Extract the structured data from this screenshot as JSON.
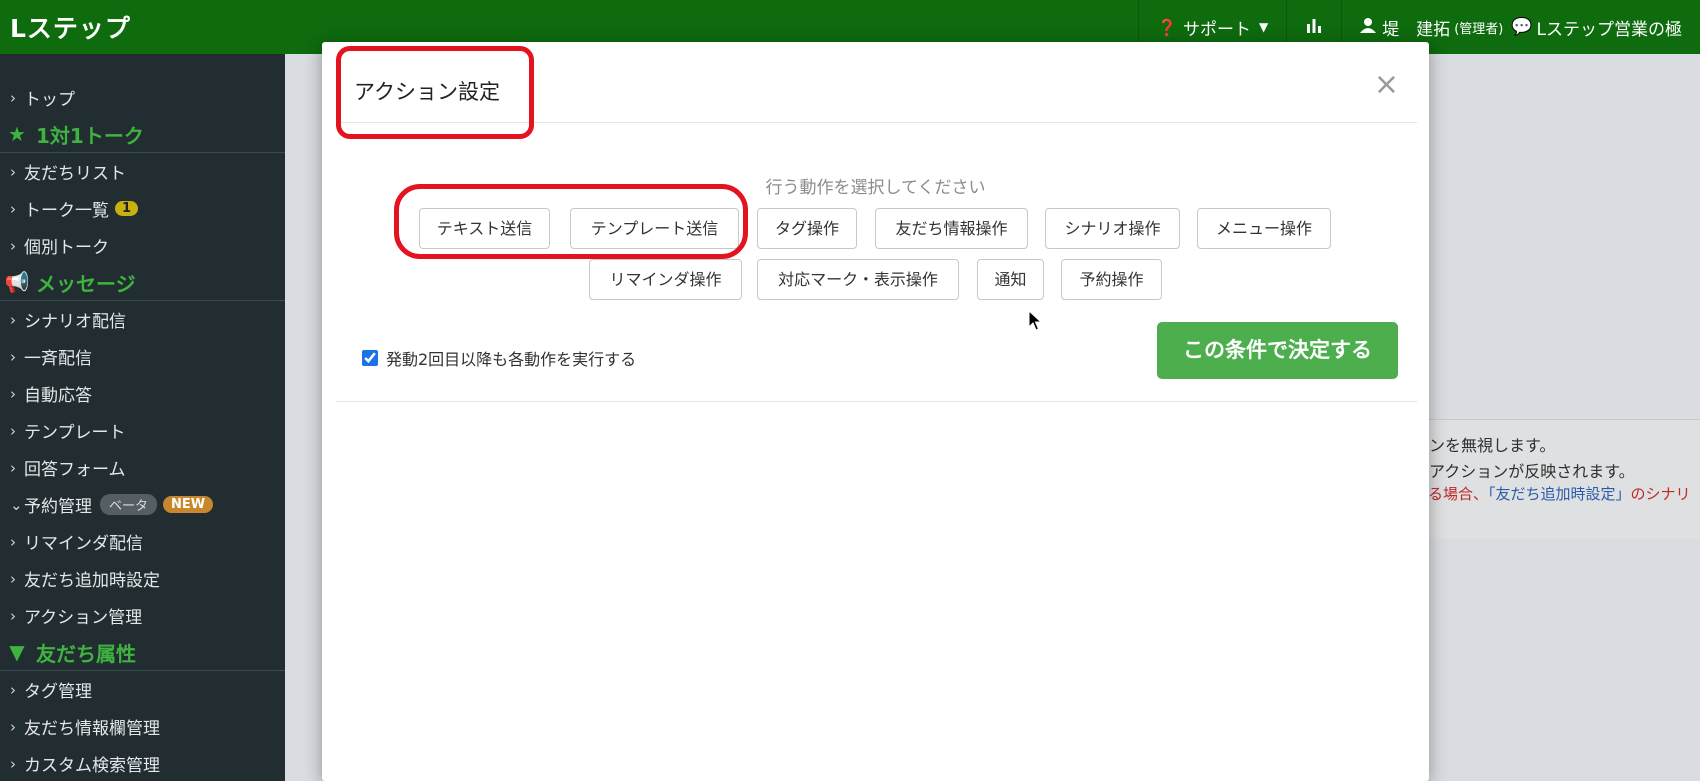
{
  "topbar": {
    "brand": "Lステップ",
    "support_label": "サポート",
    "user_name": "堤　建拓",
    "user_role": "(管理者)",
    "account_label": "Lステップ営業の極"
  },
  "sidebar": {
    "top": "トップ",
    "sec_talk": "1対1トーク",
    "friend_list": "友だちリスト",
    "talk_list": "トーク一覧",
    "talk_badge": "1",
    "individual_talk": "個別トーク",
    "sec_message": "メッセージ",
    "scenario": "シナリオ配信",
    "broadcast": "一斉配信",
    "auto_reply": "自動応答",
    "template": "テンプレート",
    "answer_form": "回答フォーム",
    "reservation": "予約管理",
    "beta_badge": "ベータ",
    "new_badge": "NEW",
    "reminder": "リマインダ配信",
    "friend_add_setting": "友だち追加時設定",
    "action_mgmt": "アクション管理",
    "sec_friend_attr": "友だち属性",
    "tag_mgmt": "タグ管理",
    "friend_info_mgmt": "友だち情報欄管理",
    "custom_search_mgmt": "カスタム検索管理"
  },
  "background": {
    "line1": "ョンを無視します。",
    "line2": "のアクションが反映されます。",
    "line3_red": "いる場合、",
    "line3_blue": "「友だち追加時設定」",
    "line3_red2": "のシナリ"
  },
  "modal": {
    "title": "アクション設定",
    "hint": "行う動作を選択してください",
    "buttons": {
      "text_send": "テキスト送信",
      "template_send": "テンプレート送信",
      "tag_op": "タグ操作",
      "friend_info_op": "友だち情報操作",
      "scenario_op": "シナリオ操作",
      "menu_op": "メニュー操作",
      "reminder_op": "リマインダ操作",
      "mark_op": "対応マーク・表示操作",
      "notify": "通知",
      "reserve_op": "予約操作"
    },
    "checkbox_label": "発動2回目以降も各動作を実行する",
    "checkbox_checked": true,
    "submit_label": "この条件で決定する"
  }
}
